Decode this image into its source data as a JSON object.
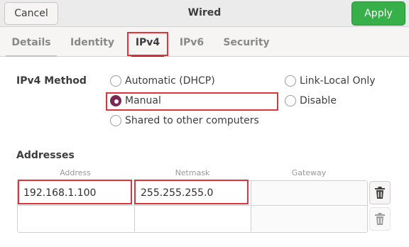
{
  "window": {
    "title": "Wired",
    "cancel_label": "Cancel",
    "apply_label": "Apply"
  },
  "tabs": [
    {
      "label": "Details",
      "active": false
    },
    {
      "label": "Identity",
      "active": false
    },
    {
      "label": "IPv4",
      "active": true
    },
    {
      "label": "IPv6",
      "active": false
    },
    {
      "label": "Security",
      "active": false
    }
  ],
  "ipv4": {
    "method_label": "IPv4 Method",
    "options": {
      "automatic": "Automatic (DHCP)",
      "manual": "Manual",
      "shared": "Shared to other computers",
      "link_local": "Link-Local Only",
      "disable": "Disable"
    },
    "selected": "manual"
  },
  "addresses": {
    "section_label": "Addresses",
    "columns": {
      "address": "Address",
      "netmask": "Netmask",
      "gateway": "Gateway"
    },
    "rows": [
      {
        "address": "192.168.1.100",
        "netmask": "255.255.255.0",
        "gateway": ""
      },
      {
        "address": "",
        "netmask": "",
        "gateway": ""
      }
    ]
  },
  "icons": {
    "delete": "trash-icon"
  },
  "colors": {
    "accent": "#772953",
    "apply": "#38b04a",
    "highlight": "#e2323a"
  }
}
